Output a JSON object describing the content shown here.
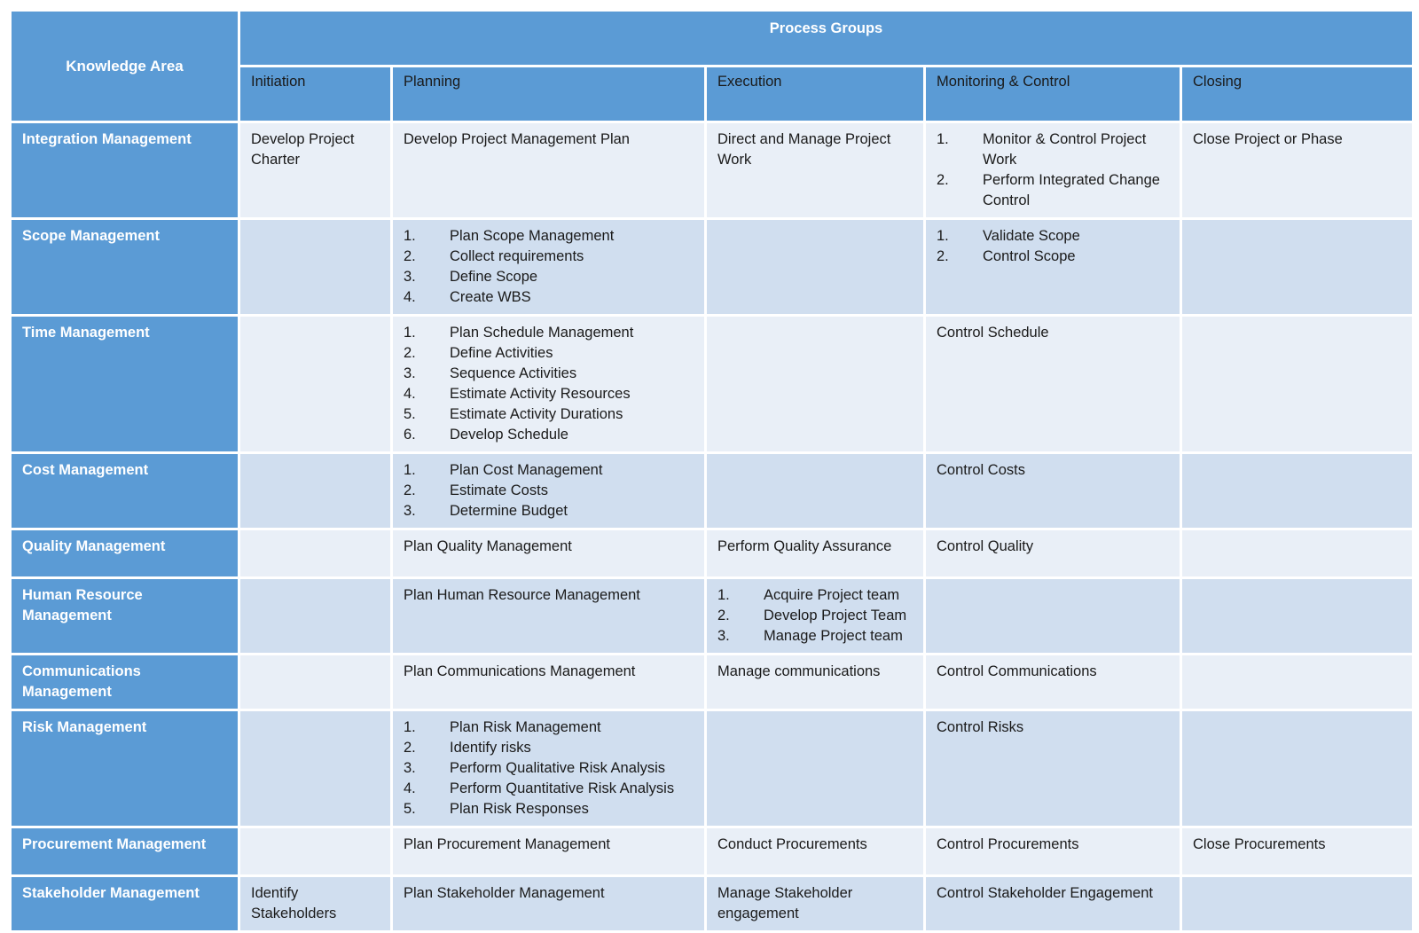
{
  "header": {
    "knowledge_area": "Knowledge Area",
    "process_groups": "Process Groups",
    "columns": [
      "Initiation",
      "Planning",
      "Execution",
      "Monitoring & Control",
      "Closing"
    ]
  },
  "rows": [
    {
      "area": "Integration Management",
      "cells": [
        [
          "Develop Project Charter"
        ],
        [
          "Develop Project Management Plan"
        ],
        [
          "Direct and Manage Project Work"
        ],
        [
          "Monitor & Control Project Work",
          "Perform Integrated Change Control"
        ],
        [
          "Close Project or Phase"
        ]
      ],
      "numbered": [
        false,
        false,
        false,
        true,
        false
      ]
    },
    {
      "area": "Scope Management",
      "cells": [
        [],
        [
          "Plan Scope Management",
          "Collect requirements",
          "Define Scope",
          "Create WBS"
        ],
        [],
        [
          "Validate Scope",
          "Control Scope"
        ],
        []
      ],
      "numbered": [
        false,
        true,
        false,
        true,
        false
      ]
    },
    {
      "area": "Time Management",
      "cells": [
        [],
        [
          "Plan Schedule Management",
          "Define Activities",
          "Sequence Activities",
          "Estimate Activity Resources",
          "Estimate Activity Durations",
          "Develop Schedule"
        ],
        [],
        [
          "Control Schedule"
        ],
        []
      ],
      "numbered": [
        false,
        true,
        false,
        false,
        false
      ]
    },
    {
      "area": "Cost Management",
      "cells": [
        [],
        [
          "Plan Cost Management",
          "Estimate Costs",
          "Determine Budget"
        ],
        [],
        [
          "Control Costs"
        ],
        []
      ],
      "numbered": [
        false,
        true,
        false,
        false,
        false
      ]
    },
    {
      "area": "Quality Management",
      "cells": [
        [],
        [
          "Plan Quality Management"
        ],
        [
          "Perform Quality Assurance"
        ],
        [
          "Control Quality"
        ],
        []
      ],
      "numbered": [
        false,
        false,
        false,
        false,
        false
      ]
    },
    {
      "area": "Human Resource Management",
      "cells": [
        [],
        [
          "Plan Human Resource Management"
        ],
        [
          "Acquire Project team",
          "Develop Project Team",
          "Manage Project team"
        ],
        [],
        []
      ],
      "numbered": [
        false,
        false,
        true,
        false,
        false
      ]
    },
    {
      "area": "Communications Management",
      "cells": [
        [],
        [
          "Plan Communications Management"
        ],
        [
          "Manage communications"
        ],
        [
          "Control Communications"
        ],
        []
      ],
      "numbered": [
        false,
        false,
        false,
        false,
        false
      ]
    },
    {
      "area": "Risk Management",
      "cells": [
        [],
        [
          "Plan Risk Management",
          "Identify risks",
          "Perform Qualitative Risk Analysis",
          "Perform Quantitative Risk Analysis",
          "Plan Risk Responses"
        ],
        [],
        [
          "Control Risks"
        ],
        []
      ],
      "numbered": [
        false,
        true,
        false,
        false,
        false
      ]
    },
    {
      "area": "Procurement Management",
      "cells": [
        [],
        [
          "Plan Procurement Management"
        ],
        [
          "Conduct Procurements"
        ],
        [
          "Control Procurements"
        ],
        [
          "Close Procurements"
        ]
      ],
      "numbered": [
        false,
        false,
        false,
        false,
        false
      ]
    },
    {
      "area": "Stakeholder Management",
      "cells": [
        [
          "Identify Stakeholders"
        ],
        [
          "Plan Stakeholder Management"
        ],
        [
          "Manage Stakeholder engagement"
        ],
        [
          "Control Stakeholder Engagement"
        ],
        []
      ],
      "numbered": [
        false,
        false,
        false,
        false,
        false
      ]
    }
  ]
}
